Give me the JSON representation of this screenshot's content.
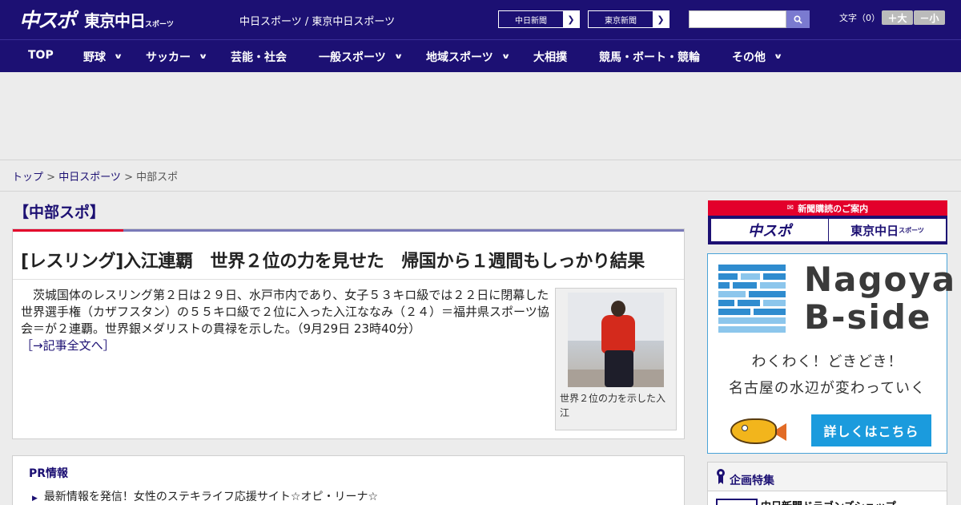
{
  "header": {
    "logo_chuspo": "中スポ",
    "logo_tokyo": "東京中日",
    "logo_tokyo_small": "スポーツ",
    "site_link_1": "中日スポーツ",
    "site_sep": " / ",
    "site_link_2": "東京中日スポーツ",
    "paper_btn_1": "中日新聞",
    "paper_btn_2": "東京新聞",
    "search_placeholder": "",
    "search_icon": "search-icon",
    "fontsize_label": "文字（0）",
    "fontsize_up": "＋大",
    "fontsize_down": "－小"
  },
  "nav": {
    "items": [
      {
        "label": "TOP"
      },
      {
        "label": "野球"
      },
      {
        "label": "サッカー"
      },
      {
        "label": "芸能・社会"
      },
      {
        "label": "一般スポーツ"
      },
      {
        "label": "地域スポーツ"
      },
      {
        "label": "大相撲"
      },
      {
        "label": "競馬・ボート・競輪"
      },
      {
        "label": "その他"
      }
    ],
    "chevron": "⌄"
  },
  "breadcrumb": {
    "top": "トップ",
    "sep": " > ",
    "chunichi": "中日スポーツ",
    "current": "中部スポ"
  },
  "section": {
    "title": "【中部スポ】"
  },
  "article": {
    "title": "[レスリング]入江連覇　世界２位の力を見せた　帰国から１週間もしっかり結果",
    "body": "　茨城国体のレスリング第２日は２９日、水戸市内であり、女子５３キロ級では２２日に閉幕した世界選手権（カザフスタン）の５５キロ級で２位に入った入江ななみ（２４）＝福井県スポーツ協会＝が２連覇。世界銀メダリストの貫禄を示した。（9月29日 23時40分）",
    "more": "［→記事全文へ］",
    "photo_caption": "世界２位の力を示した入江"
  },
  "pr": {
    "title": "PR情報",
    "item": "最新情報を発信！女性のステキライフ応援サイト☆オピ・リーナ☆"
  },
  "sidebar": {
    "subscribe_head": "新聞購読のご案内",
    "subscribe_1": "中スポ",
    "subscribe_2": "東京中日",
    "subscribe_2_small": "スポーツ",
    "bside_title_1": "Nagoya",
    "bside_title_2": "B-side",
    "bside_line1": "わくわく！どきどき！",
    "bside_line2": "名古屋の水辺が変わっていく",
    "bside_button": "詳しくはこちら",
    "feature_title": "企画特集",
    "feature_item": "中日新聞ドラゴンズショップ"
  },
  "colors": {
    "brand_navy": "#1c1073",
    "accent_red": "#e3002b",
    "bside_blue": "#1b9bdd"
  }
}
